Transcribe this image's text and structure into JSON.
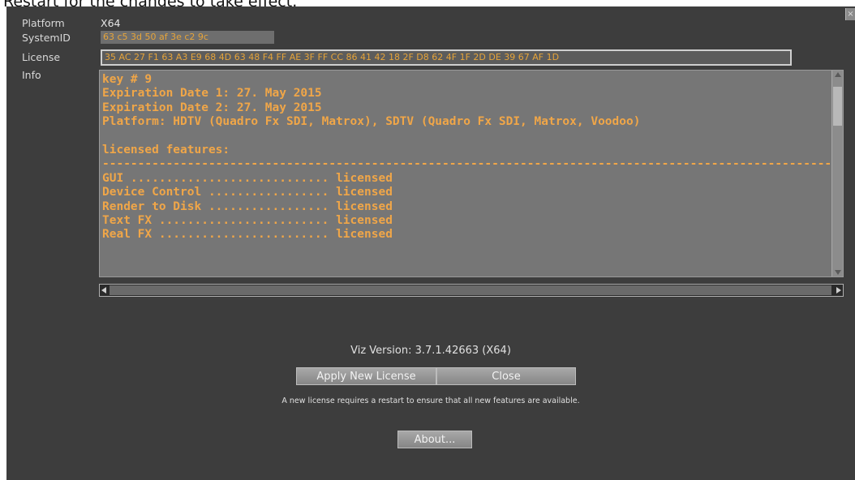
{
  "header_note": "Restart for the changes to take effect.",
  "dialog": {
    "close_glyph": "×",
    "labels": {
      "platform": "Platform",
      "systemid": "SystemID",
      "license": "License",
      "info": "Info"
    },
    "platform_value": "X64",
    "systemid_value": "63 c5 3d 50 af 3e c2 9c",
    "license_value": "35 AC 27 F1 63 A3 E9 68 4D 63 48 F4 FF AE 3F FF CC 86 41 42 18 2F D8 62 4F 1F 2D DE 39 67 AF 1D",
    "info_lines": [
      "key # 9",
      "Expiration Date 1: 27. May 2015",
      "Expiration Date 2: 27. May 2015",
      "Platform: HDTV (Quadro Fx SDI, Matrox), SDTV (Quadro Fx SDI, Matrox, Voodoo)",
      "",
      "licensed features:",
      "---------------------------------------------------------------------------------------------------------",
      "GUI ............................ licensed",
      "Device Control ................. licensed",
      "Render to Disk ................. licensed",
      "Text FX ........................ licensed",
      "Real FX ........................ licensed"
    ],
    "version_text": "Viz Version: 3.7.1.42663 (X64)",
    "apply_button": "Apply New License",
    "close_button": "Close",
    "restart_note": "A new license requires a restart to ensure that all new features are available.",
    "about_button": "About..."
  },
  "colors": {
    "panel_bg": "#3d3d3d",
    "info_text": "#f0a648",
    "value_text": "#e6a43a"
  }
}
